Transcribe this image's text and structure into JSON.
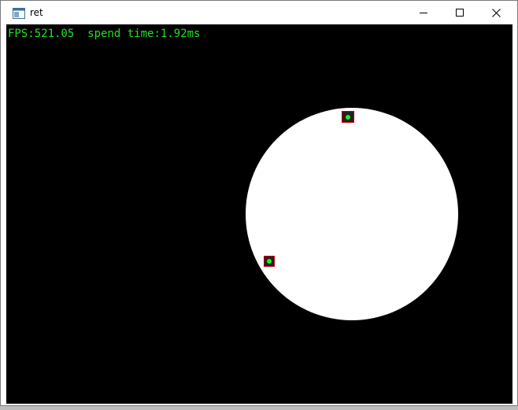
{
  "window": {
    "title": "ret",
    "icons": {
      "app": "app-window-icon",
      "minimize": "minimize-icon",
      "maximize": "maximize-icon",
      "close": "close-icon"
    }
  },
  "overlay": {
    "fps_text": "FPS:521.05  spend time:1.92ms"
  },
  "colors": {
    "canvas_bg": "#000000",
    "overlay_text": "#22e022",
    "circle_fill": "#ffffff",
    "marker_border": "#c00000",
    "marker_dot": "#22ee22"
  }
}
